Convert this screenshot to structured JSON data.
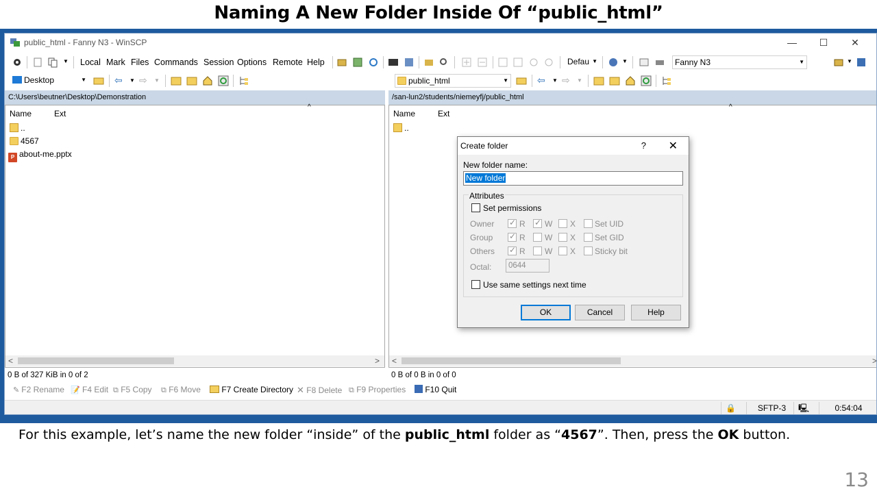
{
  "slide": {
    "title": "Naming A New Folder Inside Of “public_html”",
    "caption_parts": {
      "p1": "For this example, let’s name the new folder “inside” of the ",
      "b1": "public_html",
      "p2": " folder as “",
      "b2": "4567",
      "p3": "”. Then, press the ",
      "b3": "OK",
      "p4": " button."
    },
    "page_number": "13"
  },
  "window": {
    "title": "public_html - Fanny N3 - WinSCP",
    "minimize": "—",
    "maximize": "☐",
    "close": "✕"
  },
  "menu": [
    "Local",
    "Mark",
    "Files",
    "Commands",
    "Session",
    "Options",
    "Remote",
    "Help"
  ],
  "toolbar": {
    "transfer_combo": "Defau",
    "session_combo": "Fanny N3"
  },
  "left_pane": {
    "location_combo": "Desktop",
    "path": "C:\\Users\\beutner\\Desktop\\Demonstration",
    "columns": [
      "Name",
      "Ext"
    ],
    "rows": [
      {
        "name": "..",
        "icon": "parent-dir-icon"
      },
      {
        "name": "4567",
        "icon": "folder-icon"
      },
      {
        "name": "about-me.pptx",
        "icon": "pptx-icon"
      }
    ],
    "status": "0 B of 327 KiB in 0 of 2"
  },
  "right_pane": {
    "location_combo": "public_html",
    "path": "/san-lun2/students/niemeyfj/public_html",
    "columns": [
      "Name",
      "Ext"
    ],
    "rows": [
      {
        "name": "..",
        "icon": "parent-dir-icon"
      }
    ],
    "status": "0 B of 0 B in 0 of 0"
  },
  "fkeys": [
    {
      "label": "F2 Rename",
      "enabled": false
    },
    {
      "label": "F4 Edit",
      "enabled": false
    },
    {
      "label": "F5 Copy",
      "enabled": false
    },
    {
      "label": "F6 Move",
      "enabled": false
    },
    {
      "label": "F7 Create Directory",
      "enabled": true
    },
    {
      "label": "F8 Delete",
      "enabled": false
    },
    {
      "label": "F9 Properties",
      "enabled": false
    },
    {
      "label": "F10 Quit",
      "enabled": true
    }
  ],
  "bottom_status": {
    "protocol": "SFTP-3",
    "time": "0:54:04"
  },
  "dialog": {
    "title": "Create folder",
    "help_glyph": "?",
    "close_glyph": "✕",
    "name_label": "New folder name:",
    "name_value": "New folder",
    "attributes_label": "Attributes",
    "set_permissions": "Set permissions",
    "owner": "Owner",
    "group": "Group",
    "others": "Others",
    "r": "R",
    "w": "W",
    "x": "X",
    "set_uid": "Set UID",
    "set_gid": "Set GID",
    "sticky_bit": "Sticky bit",
    "octal_label": "Octal:",
    "octal_value": "0644",
    "same_settings": "Use same settings next time",
    "ok": "OK",
    "cancel": "Cancel",
    "help": "Help"
  },
  "colors": {
    "frame_blue": "#1e5a9e",
    "path_bar": "#c9d7e6",
    "selection": "#0078d7"
  }
}
